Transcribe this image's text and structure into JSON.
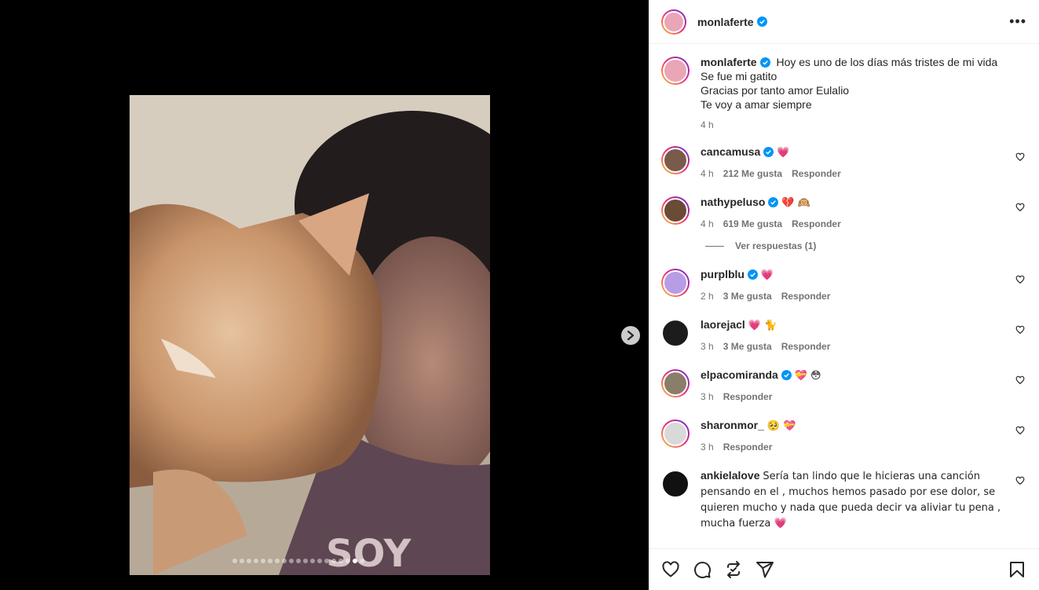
{
  "post": {
    "author": "monlaferte",
    "caption_lines": [
      "Hoy es uno de los días más tristes de mi vida",
      "Se fue mi gatito",
      "Gracias por tanto amor Eulalio",
      "Te voy a amar siempre"
    ],
    "time": "4 h",
    "carousel_dots": 19,
    "active_dot": 17
  },
  "comments": [
    {
      "user": "cancamusa",
      "verified": true,
      "text": "💗",
      "time": "4 h",
      "likes": "212 Me gusta",
      "reply": "Responder",
      "avatar_color": "#7a5a4a",
      "ring": true
    },
    {
      "user": "nathypeluso",
      "verified": true,
      "text": "💔 🙉",
      "time": "4 h",
      "likes": "619 Me gusta",
      "reply": "Responder",
      "avatar_color": "#6b4a36",
      "ring": true
    },
    {
      "user": "purplblu",
      "verified": true,
      "text": "💗",
      "time": "2 h",
      "likes": "3 Me gusta",
      "reply": "Responder",
      "avatar_color": "#b79ce6",
      "ring": true
    },
    {
      "user": "laorejacl",
      "verified": false,
      "text": "💗 🐈",
      "time": "3 h",
      "likes": "3 Me gusta",
      "reply": "Responder",
      "avatar_color": "#1c1c1c",
      "ring": false
    },
    {
      "user": "elpacomiranda",
      "verified": true,
      "text": "💝 😳",
      "time": "3 h",
      "likes": "",
      "reply": "Responder",
      "avatar_color": "#8a7d6a",
      "ring": true
    },
    {
      "user": "sharonmor_",
      "verified": false,
      "text": "🥺 💝",
      "time": "3 h",
      "likes": "",
      "reply": "Responder",
      "avatar_color": "#d9d9d9",
      "ring": true
    },
    {
      "user": "ankielalove",
      "verified": false,
      "text": "Sería tan lindo que le hicieras una canción pensando en el , muchos hemos pasado por ese dolor, se quieren mucho y nada que pueda decir va aliviar tu pena , mucha fuerza 💗",
      "time": "",
      "likes": "",
      "reply": "",
      "avatar_color": "#111111",
      "ring": false
    }
  ],
  "view_replies": "Ver respuestas (1)",
  "colors": {
    "verified": "#0095f6",
    "heart": "#ed4956",
    "muted": "#737373"
  },
  "icons": [
    "heart-icon",
    "comment-icon",
    "share-icon",
    "send-icon",
    "bookmark-icon",
    "more-icon",
    "chevron-right-icon"
  ]
}
